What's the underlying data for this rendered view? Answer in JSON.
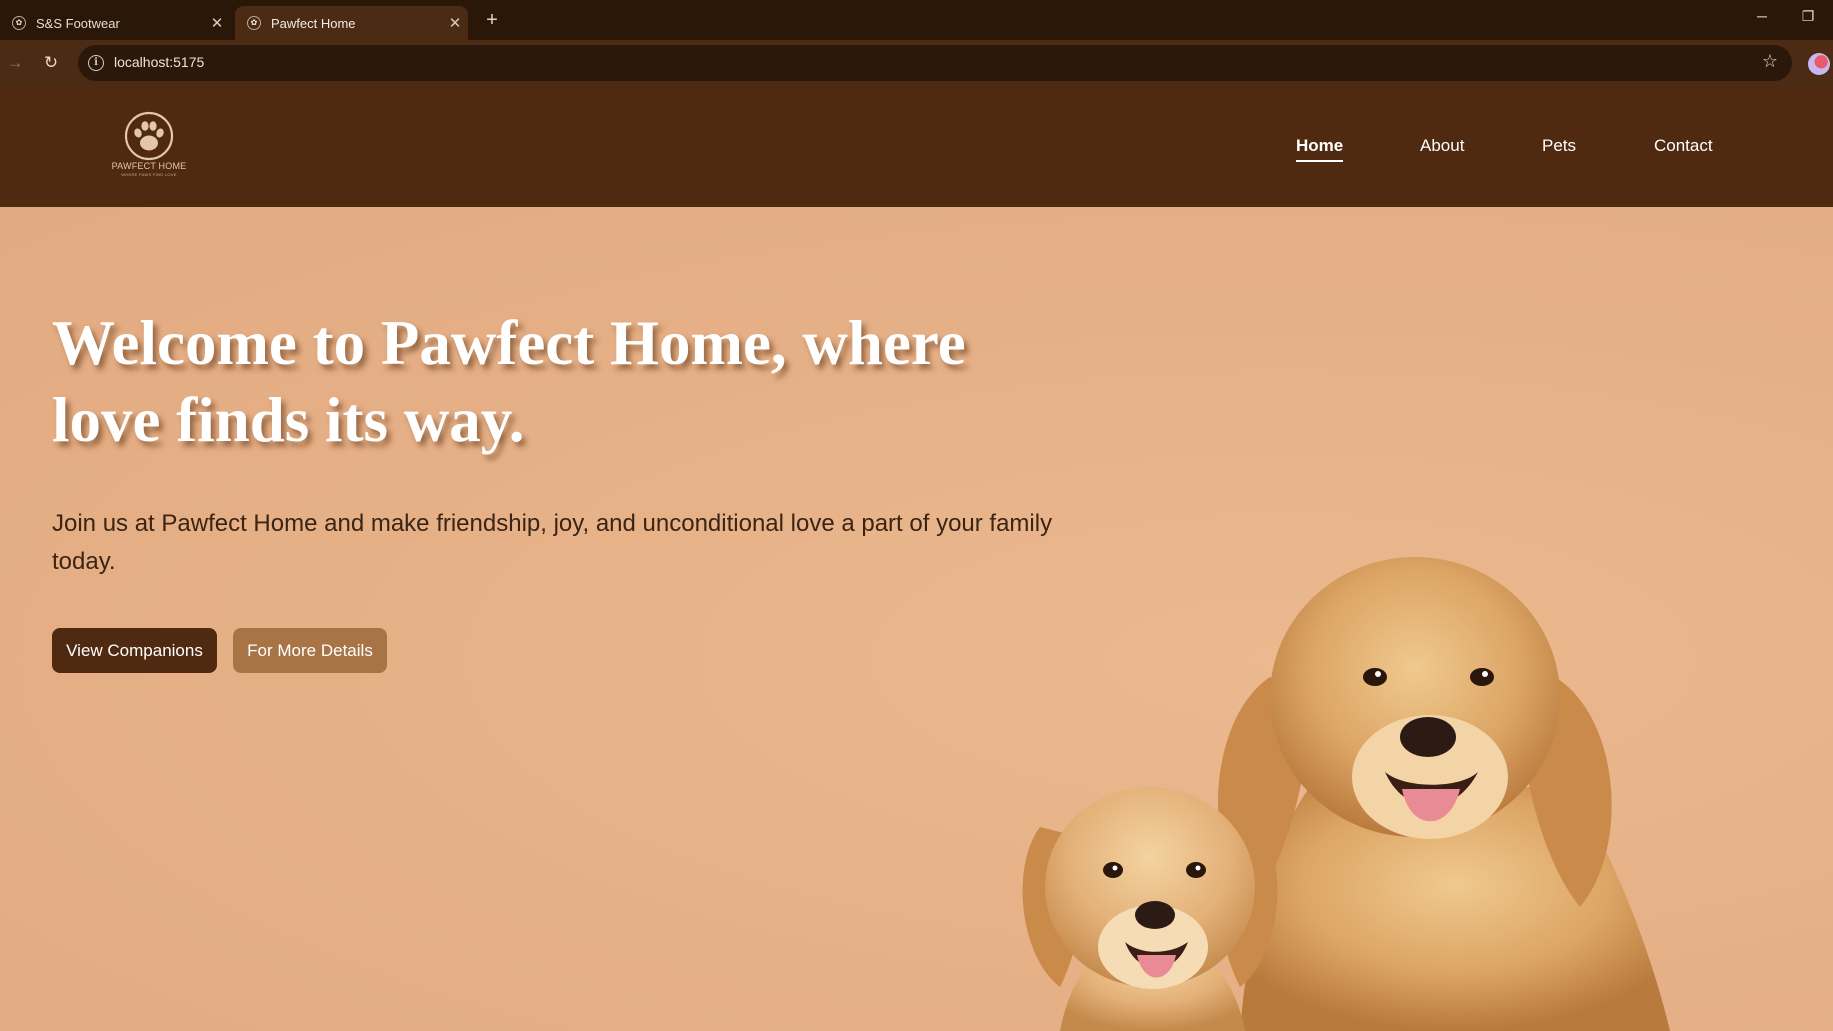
{
  "browser": {
    "tabs": [
      {
        "title": "S&S Footwear",
        "active": false
      },
      {
        "title": "Pawfect Home",
        "active": true
      }
    ],
    "new_tab_label": "+",
    "address": "localhost:5175"
  },
  "header": {
    "logo_text": "PAWFECT HOME",
    "logo_tagline": "WHERE PAWS FIND LOVE",
    "nav": [
      {
        "label": "Home",
        "active": true
      },
      {
        "label": "About"
      },
      {
        "label": "Pets"
      },
      {
        "label": "Contact"
      }
    ]
  },
  "hero": {
    "title": "Welcome to Pawfect Home, where love finds its way.",
    "subtitle": "Join us at Pawfect Home and make friendship, joy, and unconditional love a part of your family today.",
    "primary_button": "View Companions",
    "secondary_button": "For More Details"
  },
  "colors": {
    "header_bg": "#4f2a10",
    "hero_bg": "#e8b388",
    "primary_button": "#4f2a10",
    "secondary_button": "#a87446"
  },
  "icons": {
    "logo": "paw-icon",
    "reload": "reload-icon",
    "info": "info-icon",
    "bookmark": "star-icon"
  }
}
